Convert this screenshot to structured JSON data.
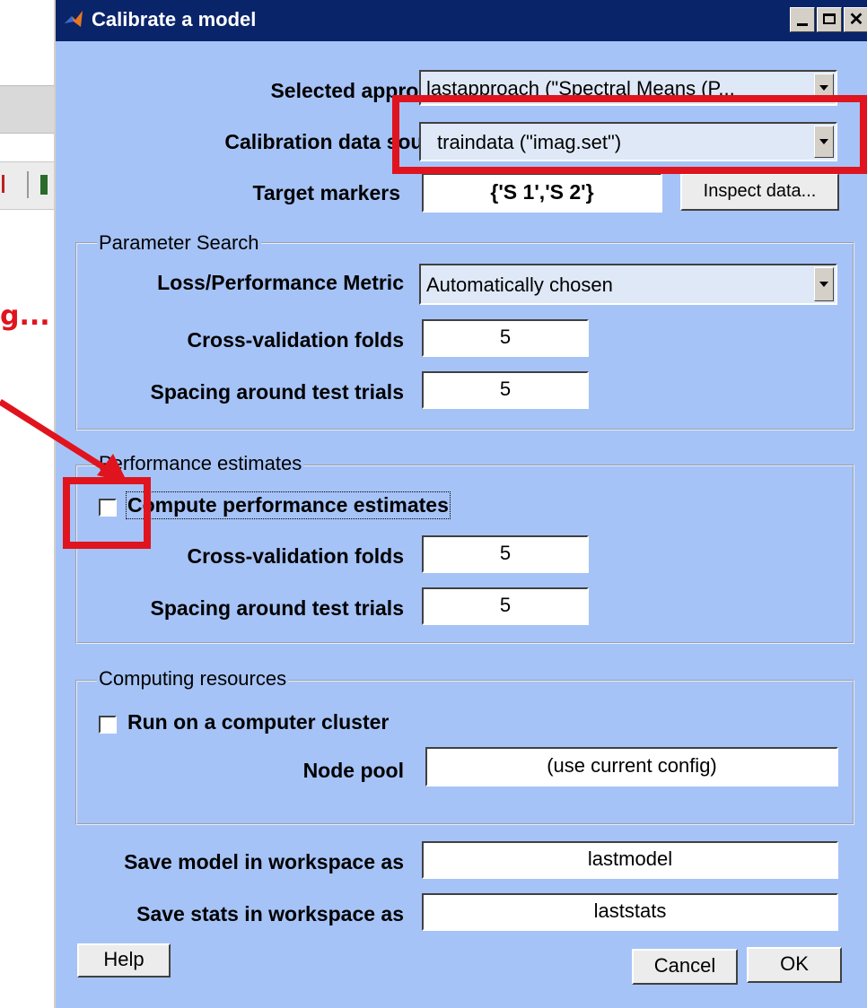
{
  "background": {
    "status_text": "g..."
  },
  "dialog": {
    "title": "Calibrate a model",
    "title_buttons": {
      "close_glyph": "✕"
    },
    "selected_approach": {
      "label": "Selected approach",
      "value": "lastapproach (\"Spectral Means (P..."
    },
    "calibration_data_source": {
      "label": "Calibration data source",
      "value": "traindata (\"imag.set\")"
    },
    "target_markers": {
      "label": "Target markers",
      "value": "{'S  1','S  2'}",
      "inspect_button": "Inspect data..."
    },
    "parameter_search": {
      "title": "Parameter Search",
      "metric_label": "Loss/Performance Metric",
      "metric_value": "Automatically chosen",
      "folds_label": "Cross-validation folds",
      "folds_value": "5",
      "spacing_label": "Spacing around test trials",
      "spacing_value": "5"
    },
    "performance_estimates": {
      "title": "Performance estimates",
      "checkbox_label": "Compute performance estimates",
      "checked": false,
      "folds_label": "Cross-validation folds",
      "folds_value": "5",
      "spacing_label": "Spacing around test trials",
      "spacing_value": "5"
    },
    "computing_resources": {
      "title": "Computing resources",
      "checkbox_label": "Run on a computer cluster",
      "checked": false,
      "node_pool_label": "Node pool",
      "node_pool_value": "(use current config)"
    },
    "save_model": {
      "label": "Save model in workspace as",
      "value": "lastmodel"
    },
    "save_stats": {
      "label": "Save stats in workspace as",
      "value": "laststats"
    },
    "buttons": {
      "help": "Help",
      "cancel": "Cancel",
      "ok": "OK"
    }
  },
  "colors": {
    "dialog_bg": "#a6c3f7",
    "titlebar": "#0a246a",
    "annotation_red": "#e0141e"
  }
}
